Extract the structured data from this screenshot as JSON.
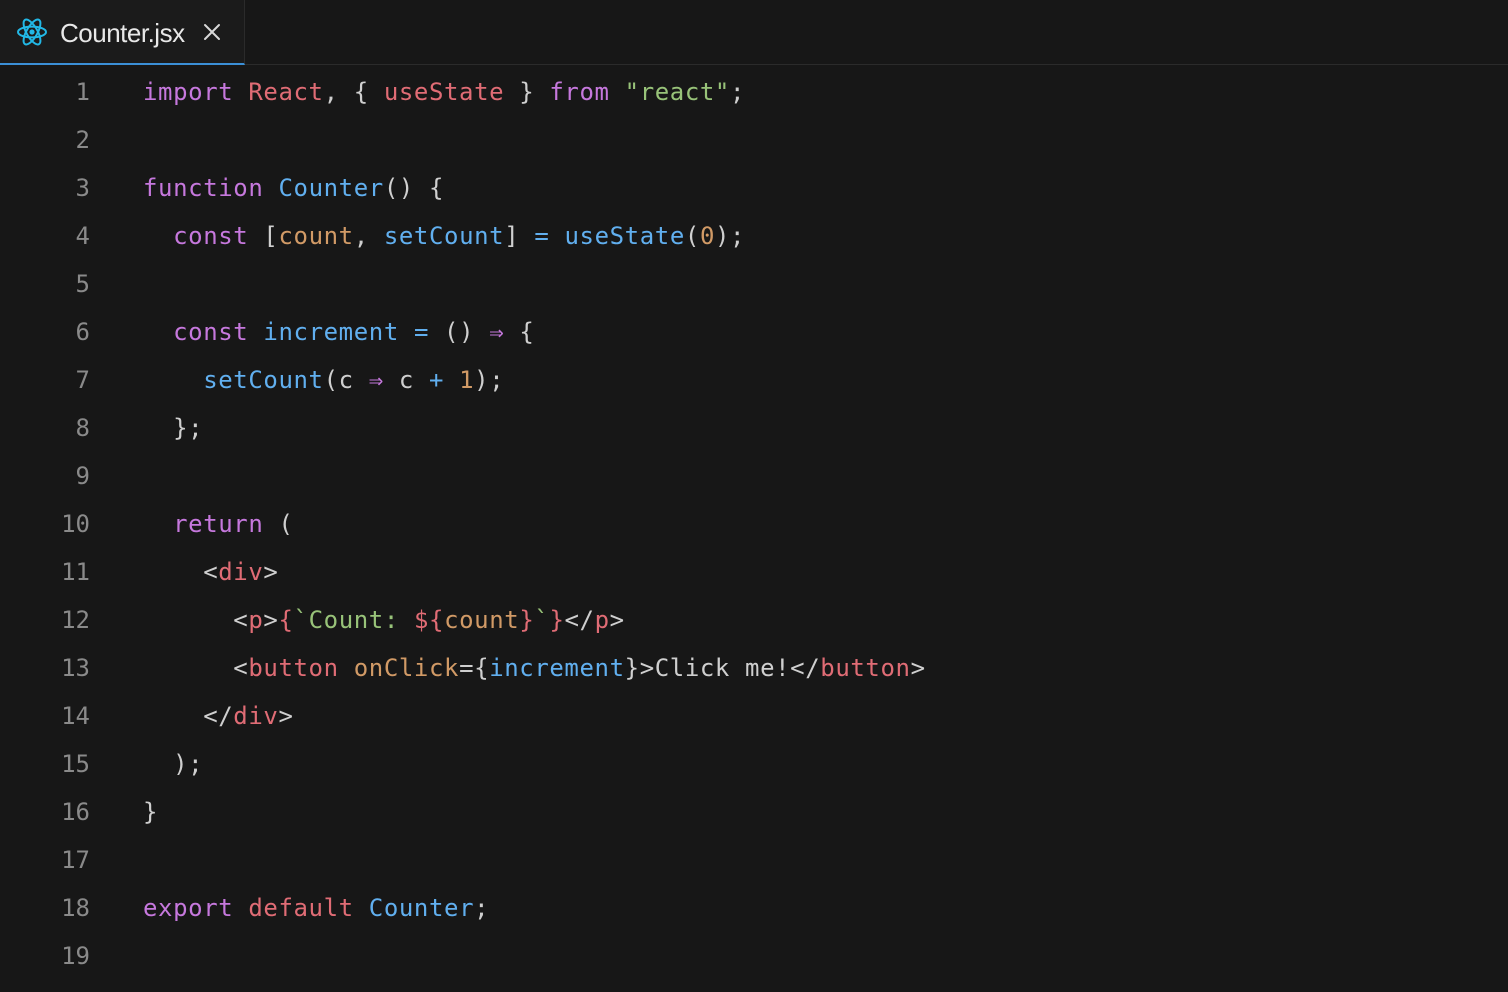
{
  "colors": {
    "background": "#171717",
    "line_number": "#8a8a8a",
    "plain": "#cfcfcf",
    "keyword": "#c678dd",
    "function": "#61afef",
    "identifier": "#e06c75",
    "variable": "#d19a66",
    "string": "#98c379",
    "tag": "#e06c75",
    "attribute": "#d19a66",
    "accent_tab": "#3b8fd6",
    "react_icon": "#22b8e6"
  },
  "tab": {
    "icon": "react-icon",
    "label": "Counter.jsx",
    "close_icon": "close-icon"
  },
  "lines": [
    {
      "number": "1",
      "tokens": [
        {
          "t": "import",
          "c": "keyword"
        },
        {
          "t": " ",
          "c": "plain"
        },
        {
          "t": "React",
          "c": "identifier"
        },
        {
          "t": ", { ",
          "c": "plain"
        },
        {
          "t": "useState",
          "c": "identifier"
        },
        {
          "t": " } ",
          "c": "plain"
        },
        {
          "t": "from",
          "c": "keyword"
        },
        {
          "t": " ",
          "c": "plain"
        },
        {
          "t": "\"react\"",
          "c": "string"
        },
        {
          "t": ";",
          "c": "plain"
        }
      ]
    },
    {
      "number": "2",
      "tokens": []
    },
    {
      "number": "3",
      "tokens": [
        {
          "t": "function",
          "c": "keyword"
        },
        {
          "t": " ",
          "c": "plain"
        },
        {
          "t": "Counter",
          "c": "function"
        },
        {
          "t": "() {",
          "c": "plain"
        }
      ]
    },
    {
      "number": "4",
      "tokens": [
        {
          "t": "  ",
          "c": "plain"
        },
        {
          "t": "const",
          "c": "keyword"
        },
        {
          "t": " [",
          "c": "plain"
        },
        {
          "t": "count",
          "c": "variable"
        },
        {
          "t": ", ",
          "c": "plain"
        },
        {
          "t": "setCount",
          "c": "function"
        },
        {
          "t": "] ",
          "c": "plain"
        },
        {
          "t": "=",
          "c": "function"
        },
        {
          "t": " ",
          "c": "plain"
        },
        {
          "t": "useState",
          "c": "function"
        },
        {
          "t": "(",
          "c": "plain"
        },
        {
          "t": "0",
          "c": "variable"
        },
        {
          "t": ");",
          "c": "plain"
        }
      ]
    },
    {
      "number": "5",
      "tokens": []
    },
    {
      "number": "6",
      "tokens": [
        {
          "t": "  ",
          "c": "plain"
        },
        {
          "t": "const",
          "c": "keyword"
        },
        {
          "t": " ",
          "c": "plain"
        },
        {
          "t": "increment",
          "c": "function"
        },
        {
          "t": " ",
          "c": "plain"
        },
        {
          "t": "=",
          "c": "function"
        },
        {
          "t": " () ",
          "c": "plain"
        },
        {
          "t": "⇒",
          "c": "keyword"
        },
        {
          "t": " {",
          "c": "plain"
        }
      ]
    },
    {
      "number": "7",
      "tokens": [
        {
          "t": "    ",
          "c": "plain"
        },
        {
          "t": "setCount",
          "c": "function"
        },
        {
          "t": "(c ",
          "c": "plain"
        },
        {
          "t": "⇒",
          "c": "keyword"
        },
        {
          "t": " c ",
          "c": "plain"
        },
        {
          "t": "+",
          "c": "function"
        },
        {
          "t": " ",
          "c": "plain"
        },
        {
          "t": "1",
          "c": "variable"
        },
        {
          "t": ");",
          "c": "plain"
        }
      ]
    },
    {
      "number": "8",
      "tokens": [
        {
          "t": "  };",
          "c": "plain"
        }
      ]
    },
    {
      "number": "9",
      "tokens": []
    },
    {
      "number": "10",
      "tokens": [
        {
          "t": "  ",
          "c": "plain"
        },
        {
          "t": "return",
          "c": "keyword"
        },
        {
          "t": " (",
          "c": "plain"
        }
      ]
    },
    {
      "number": "11",
      "tokens": [
        {
          "t": "    <",
          "c": "plain"
        },
        {
          "t": "div",
          "c": "tag"
        },
        {
          "t": ">",
          "c": "plain"
        }
      ]
    },
    {
      "number": "12",
      "tokens": [
        {
          "t": "      <",
          "c": "plain"
        },
        {
          "t": "p",
          "c": "tag"
        },
        {
          "t": ">",
          "c": "plain"
        },
        {
          "t": "{",
          "c": "tag"
        },
        {
          "t": "`Count: ",
          "c": "string"
        },
        {
          "t": "${",
          "c": "tag"
        },
        {
          "t": "count",
          "c": "variable"
        },
        {
          "t": "}",
          "c": "tag"
        },
        {
          "t": "`",
          "c": "string"
        },
        {
          "t": "}",
          "c": "tag"
        },
        {
          "t": "</",
          "c": "plain"
        },
        {
          "t": "p",
          "c": "tag"
        },
        {
          "t": ">",
          "c": "plain"
        }
      ]
    },
    {
      "number": "13",
      "tokens": [
        {
          "t": "      <",
          "c": "plain"
        },
        {
          "t": "button",
          "c": "tag"
        },
        {
          "t": " ",
          "c": "plain"
        },
        {
          "t": "onClick",
          "c": "attribute"
        },
        {
          "t": "={",
          "c": "plain"
        },
        {
          "t": "increment",
          "c": "function"
        },
        {
          "t": "}>Click me!</",
          "c": "plain"
        },
        {
          "t": "button",
          "c": "tag"
        },
        {
          "t": ">",
          "c": "plain"
        }
      ]
    },
    {
      "number": "14",
      "tokens": [
        {
          "t": "    </",
          "c": "plain"
        },
        {
          "t": "div",
          "c": "tag"
        },
        {
          "t": ">",
          "c": "plain"
        }
      ]
    },
    {
      "number": "15",
      "tokens": [
        {
          "t": "  );",
          "c": "plain"
        }
      ]
    },
    {
      "number": "16",
      "tokens": [
        {
          "t": "}",
          "c": "plain"
        }
      ]
    },
    {
      "number": "17",
      "tokens": []
    },
    {
      "number": "18",
      "tokens": [
        {
          "t": "export",
          "c": "keyword"
        },
        {
          "t": " ",
          "c": "plain"
        },
        {
          "t": "default",
          "c": "identifier"
        },
        {
          "t": " ",
          "c": "plain"
        },
        {
          "t": "Counter",
          "c": "function"
        },
        {
          "t": ";",
          "c": "plain"
        }
      ]
    },
    {
      "number": "19",
      "tokens": []
    }
  ]
}
